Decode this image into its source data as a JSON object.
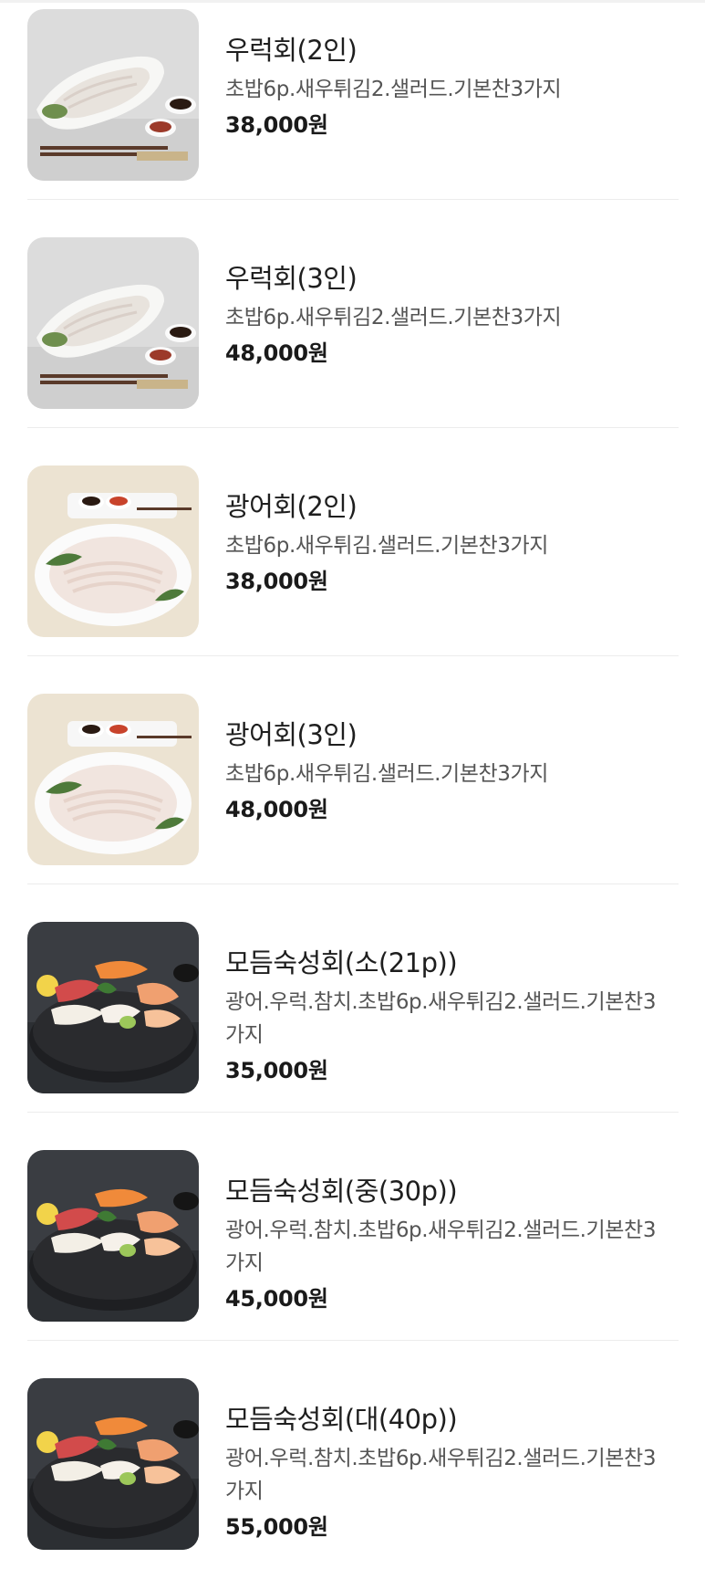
{
  "menu": {
    "items": [
      {
        "name": "우럭회(2인)",
        "description": "초밥6p.새우튀김2.샐러드.기본찬3가지",
        "price": "38,000원",
        "image": "rockfish-sashimi-platter"
      },
      {
        "name": "우럭회(3인)",
        "description": "초밥6p.새우튀김2.샐러드.기본찬3가지",
        "price": "48,000원",
        "image": "rockfish-sashimi-platter"
      },
      {
        "name": "광어회(2인)",
        "description": "초밥6p.새우튀김.샐러드.기본찬3가지",
        "price": "38,000원",
        "image": "flatfish-sashimi-plate"
      },
      {
        "name": "광어회(3인)",
        "description": "초밥6p.새우튀김.샐러드.기본찬3가지",
        "price": "48,000원",
        "image": "flatfish-sashimi-plate"
      },
      {
        "name": "모듬숙성회(소(21p))",
        "description": "광어.우럭.참치.초밥6p.새우튀김2.샐러드.기본찬3가지",
        "price": "35,000원",
        "image": "assorted-sashimi-dark-plate"
      },
      {
        "name": "모듬숙성회(중(30p))",
        "description": "광어.우럭.참치.초밥6p.새우튀김2.샐러드.기본찬3가지",
        "price": "45,000원",
        "image": "assorted-sashimi-dark-plate"
      },
      {
        "name": "모듬숙성회(대(40p))",
        "description": "광어.우럭.참치.초밥6p.새우튀김2.샐러드.기본찬3가지",
        "price": "55,000원",
        "image": "assorted-sashimi-dark-plate"
      }
    ]
  }
}
